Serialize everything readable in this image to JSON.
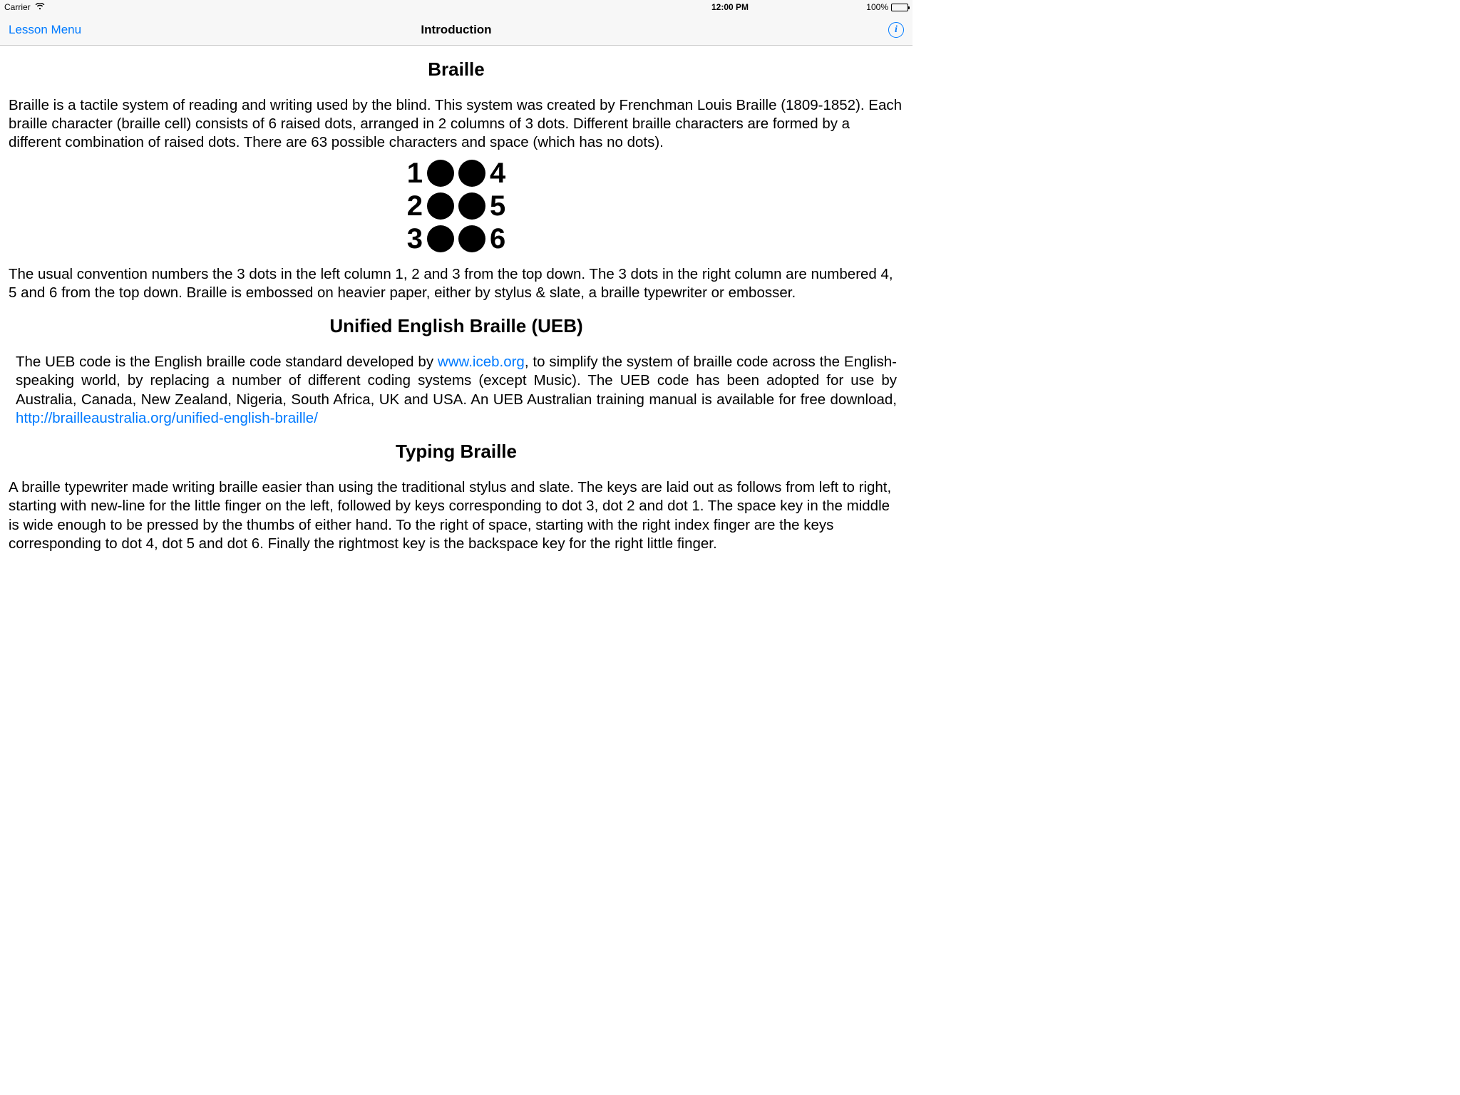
{
  "status": {
    "carrier": "Carrier",
    "time": "12:00 PM",
    "battery_pct": "100%"
  },
  "nav": {
    "back_label": "Lesson Menu",
    "title": "Introduction"
  },
  "sections": {
    "braille": {
      "heading": "Braille",
      "p1": "Braille is a tactile system of reading and writing used by the blind. This system was created by Frenchman Louis Braille (1809-1852). Each braille character (braille cell) consists of 6 raised dots, arranged in 2 columns of 3 dots. Different braille characters are formed by a different combination of raised dots. There are 63 possible characters and space (which has no dots).",
      "cell_labels": {
        "l1": "1",
        "l2": "2",
        "l3": "3",
        "r1": "4",
        "r2": "5",
        "r3": "6"
      },
      "p2": "The usual convention numbers the 3 dots in the left column 1, 2 and 3 from the top down. The 3 dots in the right column are numbered 4, 5 and 6 from the top down. Braille is embossed on heavier paper, either by stylus & slate, a braille typewriter or embosser."
    },
    "ueb": {
      "heading": "Unified English Braille (UEB)",
      "p1_a": "The UEB code is the English braille code standard developed by ",
      "link1_text": "www.iceb.org",
      "p1_b": ", to simplify the system of braille code across the English-speaking world, by replacing a number of different coding systems (except Music). The UEB code has been adopted for use by Australia, Canada, New Zealand, Nigeria, South Africa, UK and USA. An UEB Australian training manual is available for free download, ",
      "link2_text": "http://brailleaustralia.org/unified-english-braille/"
    },
    "typing": {
      "heading": "Typing Braille",
      "p1": "A braille typewriter made writing braille easier than using the traditional stylus and slate. The keys are laid out as follows from left to right, starting with new-line for the little finger on the left, followed by keys corresponding to dot 3, dot 2 and dot 1. The space key in the middle is wide enough to be pressed by the thumbs of either hand. To the right of space, starting with the right index finger are the keys corresponding to dot 4, dot 5 and dot 6. Finally the rightmost key is the backspace key for the right little finger."
    }
  }
}
